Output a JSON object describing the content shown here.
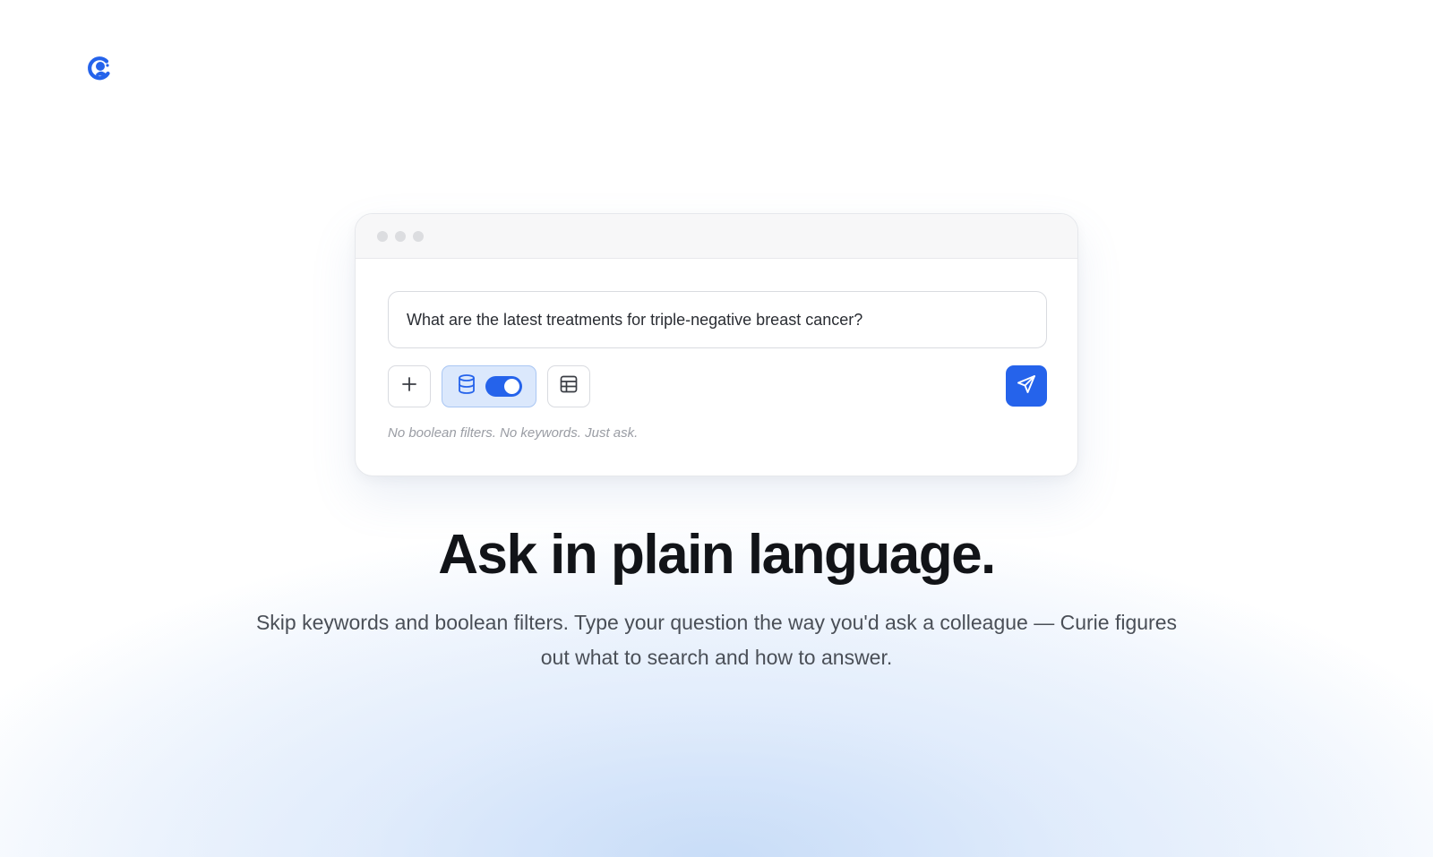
{
  "colors": {
    "accent": "#2563eb",
    "accent_light": "#dbe8fc",
    "headline": "#121418",
    "body_text": "#4a4f57",
    "hint_text": "#9a9da4"
  },
  "logo": {
    "icon": "curie-logo-icon"
  },
  "window": {
    "query_text": "What are the latest treatments for triple-negative breast cancer?",
    "toolbar": {
      "add_icon": "plus-icon",
      "database_icon": "database-icon",
      "database_toggle_on": true,
      "table_icon": "table-icon",
      "send_icon": "send-icon"
    },
    "hint": "No boolean filters. No keywords. Just ask."
  },
  "hero": {
    "headline": "Ask in plain language.",
    "subtext": "Skip keywords and boolean filters. Type your question the way you'd ask a colleague — Curie figures out what to search and how to answer."
  }
}
